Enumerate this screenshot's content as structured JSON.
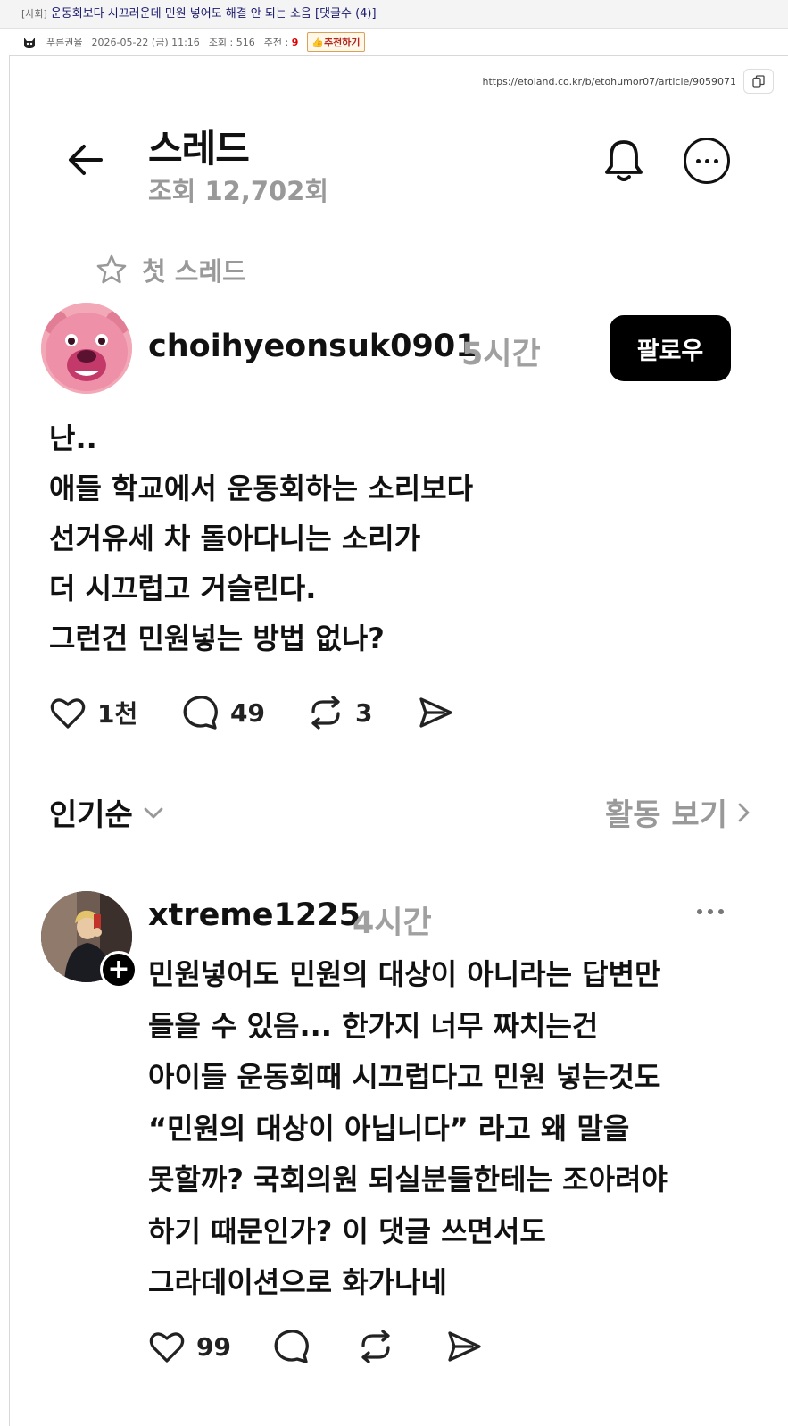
{
  "forum": {
    "category": "[사회]",
    "subject": "운동회보다 시끄러운데 민원 넣어도 해결 안 되는 소음 [댓글수 (4)]",
    "author": "푸른권율",
    "datetime": "2026-05-22 (금) 11:16",
    "views": "조회 : 516",
    "recommend_label": "추천 :",
    "recommend_count": "9",
    "recommend_button": "추천하기"
  },
  "screenshot": {
    "url": "https://etoland.co.kr/b/etohumor07/article/9059071",
    "header": {
      "title": "스레드",
      "views": "조회 12,702회"
    },
    "first_thread_label": "첫 스레드",
    "post": {
      "username": "choihyeonsuk0901",
      "time": "5시간",
      "follow_label": "팔로우",
      "lines": [
        "난..",
        "애들 학교에서 운동회하는 소리보다",
        "선거유세 차 돌아다니는 소리가",
        "더 시끄럽고 거슬린다.",
        "그런건 민원넣는 방법 없나?"
      ],
      "likes": "1천",
      "comments": "49",
      "reposts": "3"
    },
    "sort": {
      "label": "인기순",
      "activity_label": "활동 보기"
    },
    "reply": {
      "username": "xtreme1225",
      "time": "4시간",
      "lines": [
        "민원넣어도 민원의 대상이 아니라는 답변만",
        "들을 수 있음... 한가지 너무 짜치는건",
        "아이들 운동회때 시끄럽다고 민원 넣는것도",
        "“민원의 대상이 아닙니다”  라고 왜 말을",
        "못할까? 국회의원 되실분들한테는 조아려야",
        "하기 때문인가? 이 댓글 쓰면서도",
        "그라데이션으로 화가나네"
      ],
      "likes": "99"
    }
  }
}
